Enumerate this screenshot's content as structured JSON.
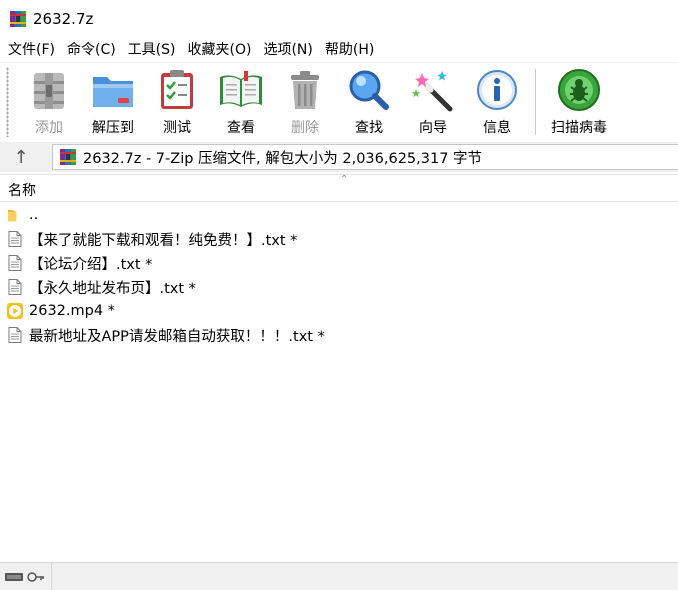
{
  "window": {
    "title": "2632.7z"
  },
  "menu": [
    {
      "label": "文件(F)"
    },
    {
      "label": "命令(C)"
    },
    {
      "label": "工具(S)"
    },
    {
      "label": "收藏夹(O)"
    },
    {
      "label": "选项(N)"
    },
    {
      "label": "帮助(H)"
    }
  ],
  "toolbar": {
    "add": {
      "label": "添加",
      "icon": "add-archive-icon",
      "enabled": false
    },
    "extract": {
      "label": "解压到",
      "icon": "extract-folder-icon",
      "enabled": true
    },
    "test": {
      "label": "测试",
      "icon": "test-clipboard-icon",
      "enabled": true
    },
    "view": {
      "label": "查看",
      "icon": "book-icon",
      "enabled": true
    },
    "delete": {
      "label": "删除",
      "icon": "trash-icon",
      "enabled": false
    },
    "find": {
      "label": "查找",
      "icon": "magnifier-icon",
      "enabled": true
    },
    "wizard": {
      "label": "向导",
      "icon": "magic-wand-icon",
      "enabled": true
    },
    "info": {
      "label": "信息",
      "icon": "info-icon",
      "enabled": true
    },
    "scan": {
      "label": "扫描病毒",
      "icon": "bug-scan-icon",
      "enabled": true
    }
  },
  "address": {
    "text": "2632.7z - 7-Zip 压缩文件, 解包大小为 2,036,625,317 字节"
  },
  "list": {
    "column_name": "名称",
    "rows": [
      {
        "name": "..",
        "type": "folder-up"
      },
      {
        "name": "【来了就能下载和观看！纯免费！】.txt *",
        "type": "text"
      },
      {
        "name": "【论坛介绍】.txt *",
        "type": "text"
      },
      {
        "name": "【永久地址发布页】.txt *",
        "type": "text"
      },
      {
        "name": "2632.mp4 *",
        "type": "video"
      },
      {
        "name": "最新地址及APP请发邮箱自动获取！！！.txt *",
        "type": "text"
      }
    ]
  },
  "colors": {
    "toolbar_bg": "#ffffff",
    "address_bg": "#f0f0f0",
    "status_bg": "#f0f0f0",
    "disabled_text": "#9a9a9a"
  }
}
